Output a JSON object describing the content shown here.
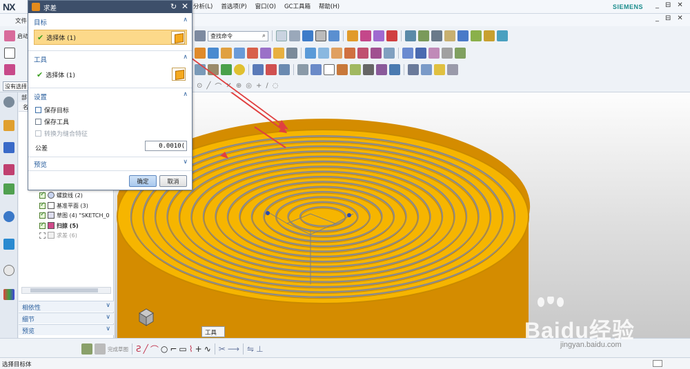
{
  "app": {
    "logo": "NX",
    "menu": [
      "文件",
      "分析(L)",
      "首选项(P)",
      "窗口(O)",
      "GC工具箱",
      "帮助(H)"
    ],
    "brand": "SIEMENS",
    "window_controls": [
      "_",
      "⊟",
      "✕"
    ]
  },
  "toolbar": {
    "search_placeholder": "查找命令",
    "start_label": "启动",
    "selection_filter": "没有选择"
  },
  "dialog": {
    "title": "求差",
    "target": {
      "heading": "目标",
      "selection": "选择体 (1)"
    },
    "tool": {
      "heading": "工具",
      "selection": "选择体 (1)"
    },
    "settings": {
      "heading": "设置",
      "keep_target": "保存目标",
      "keep_tool": "保存工具",
      "convert_to_stitch": "转换为缝合特征",
      "tolerance_label": "公差",
      "tolerance_value": "0.0010("
    },
    "preview": {
      "heading": "预览"
    },
    "ok": "确定",
    "cancel": "取消"
  },
  "navigator": {
    "header": "部",
    "column": "名",
    "items": [
      {
        "label": "螺旋线 (2)",
        "checked": true
      },
      {
        "label": "基准平面 (3)",
        "checked": true
      },
      {
        "label": "草图 (4) \"SKETCH_0",
        "checked": true
      },
      {
        "label": "扫掠 (5)",
        "checked": true,
        "bold": true
      },
      {
        "label": "求差 (6)",
        "checked": false,
        "muted": true
      }
    ],
    "panels": [
      "相依性",
      "细节",
      "预览"
    ]
  },
  "graphics": {
    "tool_tab": "工具",
    "model_color": "#f6b500",
    "edge_color": "#c98a00",
    "groove_color": "#8b8b8b"
  },
  "bottom_toolbar": {
    "finish_sketch": "完成草图"
  },
  "status": {
    "message": "选择目标体"
  },
  "watermark": {
    "text": "Baidu经验",
    "url": "jingyan.baidu.com"
  }
}
